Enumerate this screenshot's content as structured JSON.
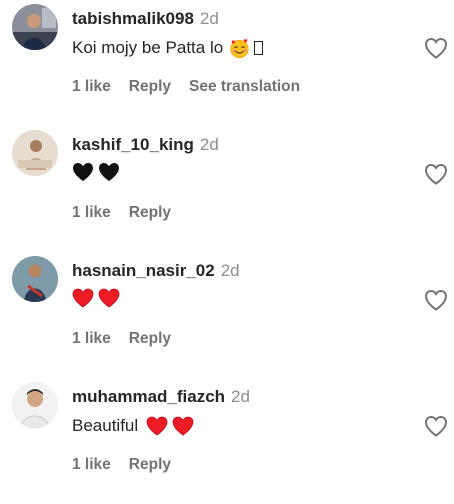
{
  "comments": [
    {
      "username": "tabishmalik098",
      "time": "2d",
      "text": "Koi mojy be Patta lo",
      "likes": "1 like",
      "reply": "Reply",
      "translate": "See translation"
    },
    {
      "username": "kashif_10_king",
      "time": "2d",
      "text": "",
      "emoji": "black-heart x2",
      "likes": "1 like",
      "reply": "Reply"
    },
    {
      "username": "hasnain_nasir_02",
      "time": "2d",
      "text": "",
      "emoji": "red-heart x2",
      "likes": "1 like",
      "reply": "Reply"
    },
    {
      "username": "muhammad_fiazch",
      "time": "2d",
      "text": "Beautiful",
      "emoji": "red-heart x2",
      "likes": "1 like",
      "reply": "Reply"
    }
  ],
  "colors": {
    "text": "#262626",
    "muted": "#8e8e8e",
    "action": "#737373",
    "heart_red": "#ed1c24",
    "heart_black": "#111111"
  },
  "icons": {
    "like": "heart-outline-icon",
    "avatar": "avatar"
  }
}
